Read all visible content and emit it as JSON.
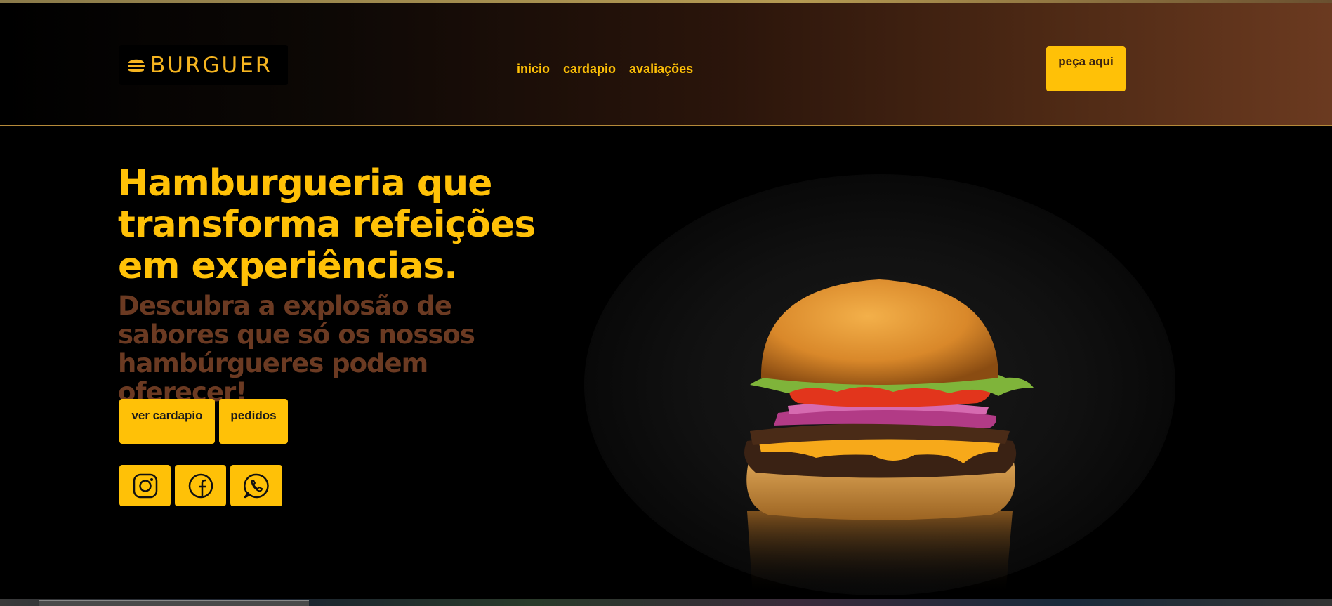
{
  "header": {
    "logo_text": "BURGUER",
    "nav": [
      {
        "label": "inicio"
      },
      {
        "label": "cardapio"
      },
      {
        "label": "avaliações"
      }
    ],
    "order_button": "peça aqui"
  },
  "hero": {
    "title": "Hamburgueria que transforma refeições em experiências.",
    "subtitle": "Descubra a explosão de sabores que só os nossos hambúrgueres podem oferecer!",
    "buttons": [
      {
        "label": "ver cardapio"
      },
      {
        "label": "pedidos"
      }
    ],
    "social": [
      {
        "icon": "instagram-icon"
      },
      {
        "icon": "facebook-icon"
      },
      {
        "icon": "whatsapp-icon"
      }
    ]
  },
  "colors": {
    "accent": "#ffc107",
    "subtitle_brown": "#6b3a22",
    "background": "#000000",
    "header_gradient_end": "#6b3a20"
  }
}
